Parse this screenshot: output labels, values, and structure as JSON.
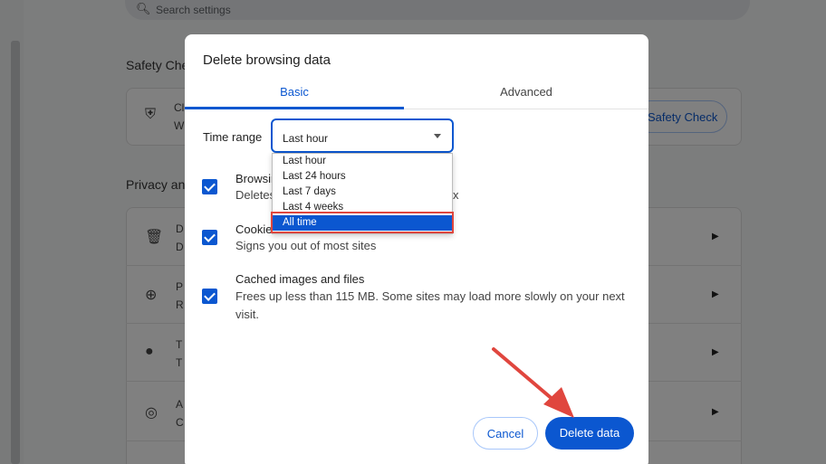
{
  "background": {
    "search_placeholder": "Search settings",
    "section_safety": "Safety Che",
    "safety_card_line1": "Cl",
    "safety_card_line2": "W",
    "safety_button": "Safety Check",
    "section_privacy": "Privacy an",
    "rows": [
      {
        "icon": "trash-icon",
        "l1": "D",
        "l2": "D"
      },
      {
        "icon": "compass-icon",
        "l1": "P",
        "l2": "R"
      },
      {
        "icon": "cookie-icon",
        "l1": "T",
        "l2": "T"
      },
      {
        "icon": "ad-icon",
        "l1": "A",
        "l2": "C"
      }
    ]
  },
  "dialog": {
    "title": "Delete browsing data",
    "tabs": [
      "Basic",
      "Advanced"
    ],
    "time_range_label": "Time range",
    "time_range_value": "Last hour",
    "options": [
      "Last hour",
      "Last 24 hours",
      "Last 7 days",
      "Last 4 weeks",
      "All time"
    ],
    "selected_option": "All time",
    "items": [
      {
        "title": "Browsir",
        "desc": "Deletes",
        "desc_tail": "x"
      },
      {
        "title": "Cookie",
        "desc": "Signs you out of most sites"
      },
      {
        "title": "Cached images and files",
        "desc": "Frees up less than 115 MB. Some sites may load more slowly on your next visit."
      }
    ],
    "cancel_label": "Cancel",
    "delete_label": "Delete data"
  },
  "colors": {
    "accent": "#0b57d0",
    "annotation": "#e0463e"
  }
}
